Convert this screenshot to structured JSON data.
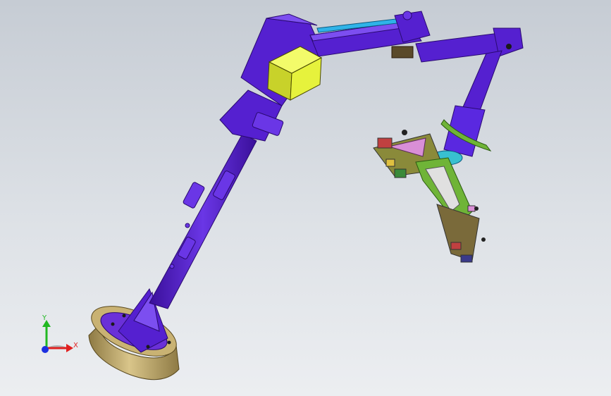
{
  "viewport": {
    "background_top": "#c6ccd4",
    "background_bottom": "#eceef1"
  },
  "model": {
    "colors": {
      "arm": "#5520d0",
      "arm_dark": "#3a0f9a",
      "arm_light": "#7c4ef0",
      "motor_box": "#e6f23c",
      "base_ring": "#c2aa6a",
      "base_ring_dark": "#8e7a44",
      "link_rod": "#2fb3e8",
      "gripper_green": "#6fb437",
      "gripper_pink": "#d98fd6"
    }
  },
  "triad": {
    "x_label": "X",
    "y_label": "Y",
    "x_color": "#e02020",
    "y_color": "#22b822",
    "z_color": "#1c2fe0"
  }
}
